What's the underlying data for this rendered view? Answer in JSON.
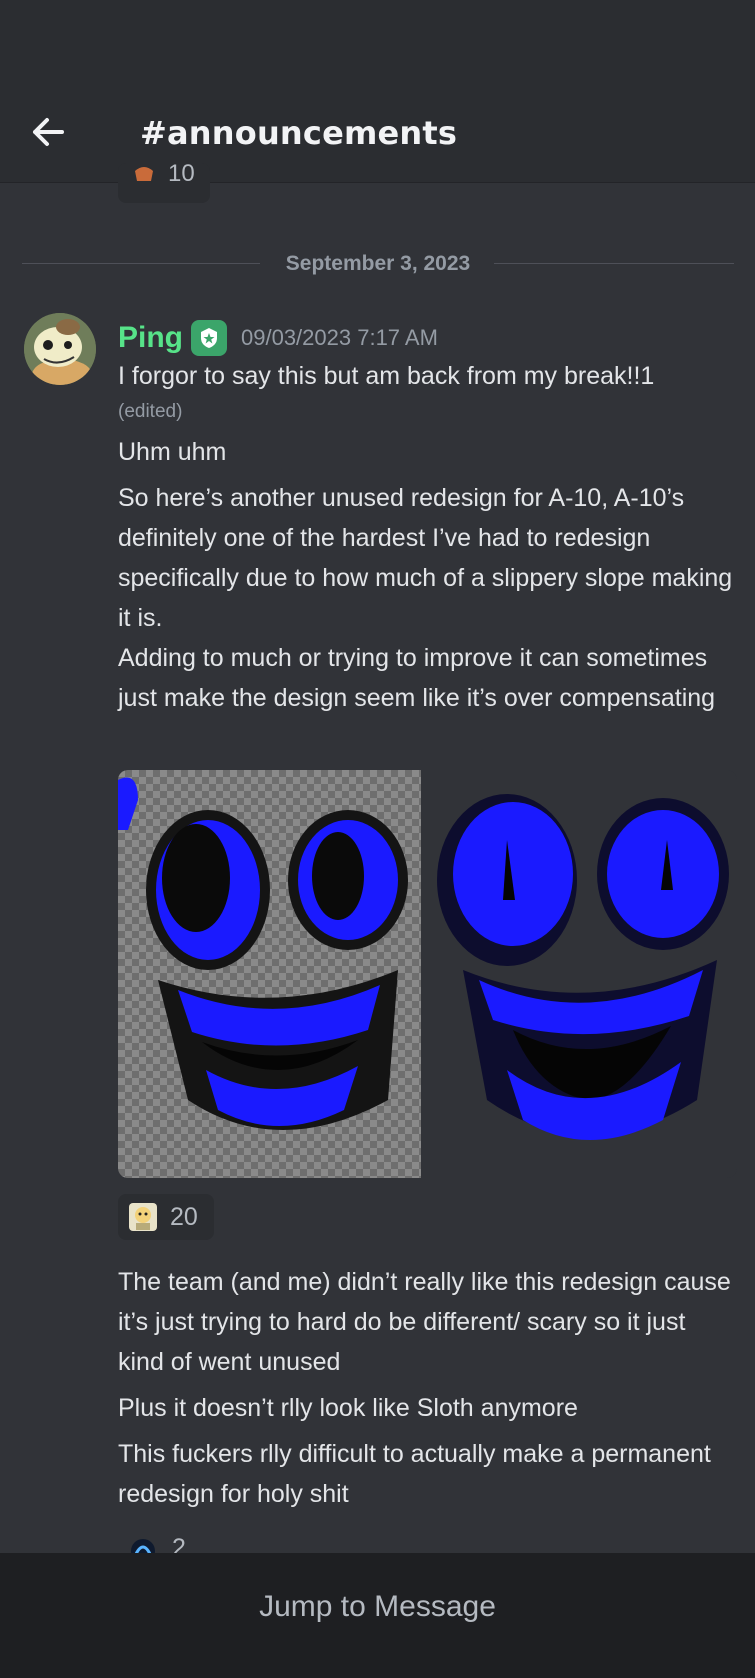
{
  "header": {
    "title": "#announcements"
  },
  "previous_reaction": {
    "count": "10"
  },
  "divider": {
    "date": "September 3, 2023"
  },
  "message": {
    "author": "Ping",
    "timestamp": "09/03/2023 7:17 AM",
    "line1": "I forgor to say this but am back from my break!!1",
    "edited": "(edited)",
    "line2": "Uhm uhm",
    "para1": "So here’s another unused redesign for A-10, A-10’s definitely one of the hardest I’ve had to redesign specifically due to how much of a slippery slope making it is.",
    "para2": "Adding to much or trying to improve it can sometimes just make the design seem like it’s over compensating",
    "para3": "The team (and me) didn’t really like this redesign cause it’s just trying to hard do be different/ scary so it just kind of went unused",
    "para4": "Plus it doesn’t rlly look like Sloth anymore",
    "para5": "This fuckers rlly difficult to actually make a permanent redesign for holy shit"
  },
  "reaction": {
    "count": "20"
  },
  "next_reaction": {
    "count": "2"
  },
  "jump": {
    "label": "Jump to Message"
  },
  "colors": {
    "background": "#313338",
    "header": "#2b2d31",
    "username": "#57e389",
    "accent_blue": "#1a1aff"
  }
}
